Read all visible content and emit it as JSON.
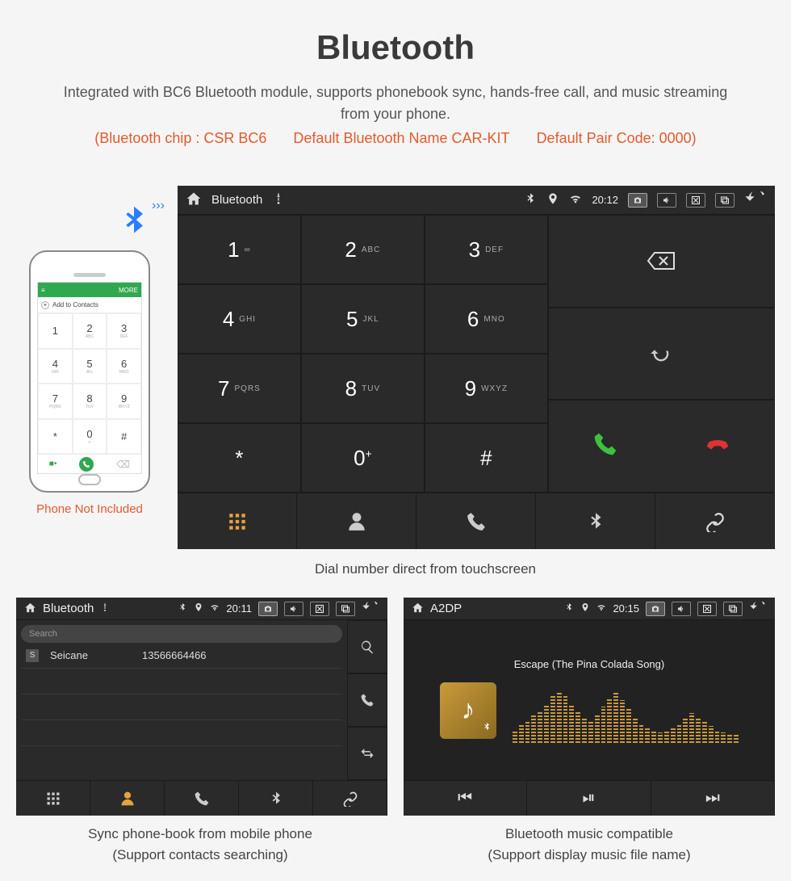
{
  "header": {
    "title": "Bluetooth",
    "description": "Integrated with BC6 Bluetooth module, supports phonebook sync, hands-free call, and music streaming from your phone.",
    "spec_chip": "(Bluetooth chip : CSR BC6",
    "spec_name": "Default Bluetooth Name CAR-KIT",
    "spec_code": "Default Pair Code: 0000)"
  },
  "phone_mock": {
    "top_left": "≡",
    "top_right": "MORE",
    "add_contacts": "Add to Contacts",
    "keys": [
      {
        "n": "1",
        "s": ""
      },
      {
        "n": "2",
        "s": "ABC"
      },
      {
        "n": "3",
        "s": "DEF"
      },
      {
        "n": "4",
        "s": "GHI"
      },
      {
        "n": "5",
        "s": "JKL"
      },
      {
        "n": "6",
        "s": "MNO"
      },
      {
        "n": "7",
        "s": "PQRS"
      },
      {
        "n": "8",
        "s": "TUV"
      },
      {
        "n": "9",
        "s": "WXYZ"
      },
      {
        "n": "*",
        "s": ""
      },
      {
        "n": "0",
        "s": "+"
      },
      {
        "n": "#",
        "s": ""
      }
    ],
    "note": "Phone Not Included"
  },
  "unit_main": {
    "status": {
      "title": "Bluetooth",
      "time": "20:12"
    },
    "keys": [
      {
        "n": "1",
        "s": "∞"
      },
      {
        "n": "2",
        "s": "ABC"
      },
      {
        "n": "3",
        "s": "DEF"
      },
      {
        "n": "4",
        "s": "GHI"
      },
      {
        "n": "5",
        "s": "JKL"
      },
      {
        "n": "6",
        "s": "MNO"
      },
      {
        "n": "7",
        "s": "PQRS"
      },
      {
        "n": "8",
        "s": "TUV"
      },
      {
        "n": "9",
        "s": "WXYZ"
      },
      {
        "n": "*",
        "s": ""
      },
      {
        "n": "0",
        "s": "+"
      },
      {
        "n": "#",
        "s": ""
      }
    ],
    "caption": "Dial number direct from touchscreen"
  },
  "unit_pb": {
    "status": {
      "title": "Bluetooth",
      "time": "20:11"
    },
    "search_placeholder": "Search",
    "contact": {
      "initial": "S",
      "name": "Seicane",
      "number": "13566664466"
    },
    "caption_l1": "Sync phone-book from mobile phone",
    "caption_l2": "(Support contacts searching)"
  },
  "unit_music": {
    "status": {
      "title": "A2DP",
      "time": "20:15"
    },
    "track": "Escape (The Pina Colada Song)",
    "viz_heights": [
      20,
      28,
      34,
      42,
      50,
      60,
      72,
      80,
      72,
      60,
      48,
      40,
      34,
      42,
      56,
      70,
      80,
      66,
      52,
      40,
      30,
      24,
      20,
      16,
      18,
      22,
      30,
      38,
      46,
      40,
      32,
      26,
      20,
      16,
      14,
      12
    ],
    "caption_l1": "Bluetooth music compatible",
    "caption_l2": "(Support display music file name)"
  }
}
